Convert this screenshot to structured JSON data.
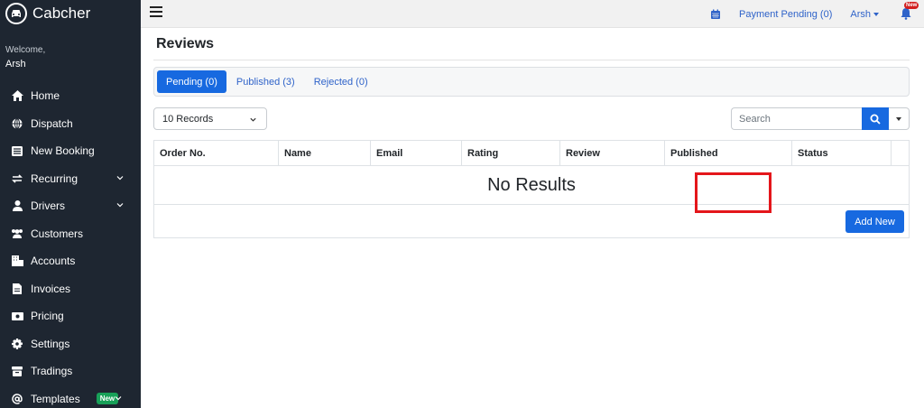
{
  "app": {
    "name": "Cabcher"
  },
  "sidebar": {
    "welcome": "Welcome,",
    "username": "Arsh",
    "items": [
      {
        "label": "Home",
        "icon": "home-icon",
        "chevron": false
      },
      {
        "label": "Dispatch",
        "icon": "globe-icon",
        "chevron": false
      },
      {
        "label": "New Booking",
        "icon": "list-icon",
        "chevron": false
      },
      {
        "label": "Recurring",
        "icon": "repeat-icon",
        "chevron": true
      },
      {
        "label": "Drivers",
        "icon": "user-icon",
        "chevron": true
      },
      {
        "label": "Customers",
        "icon": "users-icon",
        "chevron": false
      },
      {
        "label": "Accounts",
        "icon": "building-icon",
        "chevron": false
      },
      {
        "label": "Invoices",
        "icon": "file-icon",
        "chevron": false
      },
      {
        "label": "Pricing",
        "icon": "money-icon",
        "chevron": false
      },
      {
        "label": "Settings",
        "icon": "gear-icon",
        "chevron": false
      },
      {
        "label": "Tradings",
        "icon": "box-icon",
        "chevron": false
      },
      {
        "label": "Templates",
        "icon": "at-icon",
        "chevron": true,
        "badge": "New"
      }
    ]
  },
  "topbar": {
    "payment_pending": "Payment Pending (0)",
    "user": "Arsh",
    "notification_badge": "New"
  },
  "page": {
    "title": "Reviews",
    "tabs": [
      {
        "label": "Pending (0)",
        "active": true
      },
      {
        "label": "Published (3)",
        "active": false
      },
      {
        "label": "Rejected (0)",
        "active": false
      }
    ],
    "records_select": "10 Records",
    "search_placeholder": "Search",
    "table": {
      "columns": [
        "Order No.",
        "Name",
        "Email",
        "Rating",
        "Review",
        "Published",
        "Status",
        ""
      ],
      "empty_text": "No Results"
    },
    "add_new_label": "Add New"
  },
  "colors": {
    "sidebar_bg": "#1e2631",
    "primary": "#1769e0",
    "link": "#2f63c9",
    "highlight": "#e4161b",
    "badge_green": "#18a058",
    "badge_red": "#d21f1f"
  }
}
